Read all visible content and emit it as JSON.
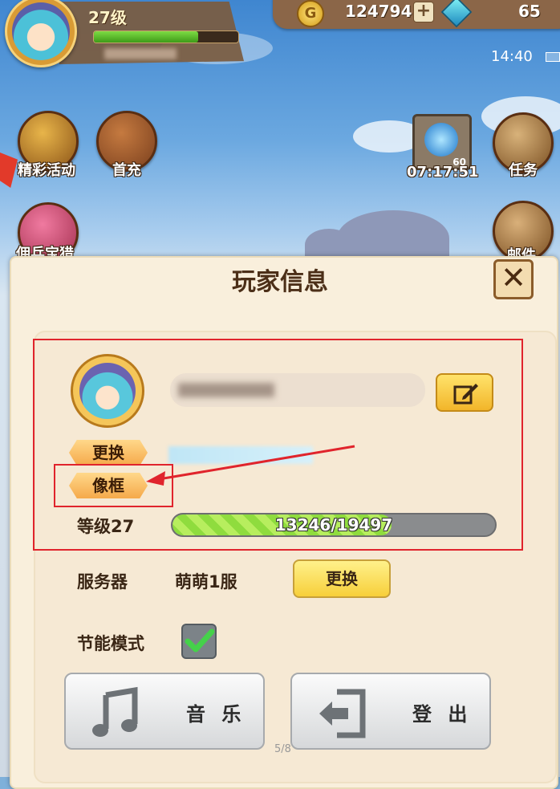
{
  "hud": {
    "level": "27级",
    "exp_fraction": 0.72,
    "gold": "124794",
    "gems": "65",
    "time": "14:40"
  },
  "world": {
    "events": "精彩活动",
    "first_charge": "首充",
    "portal_count": "60",
    "portal_timer": "07:17:51",
    "quests": "任务",
    "mercenary": "佣兵宝猎",
    "mail": "邮件"
  },
  "dialog": {
    "title": "玩家信息",
    "change_avatar_label": "更换",
    "frame_label": "像框",
    "level_label": "等级27",
    "exp_text": "13246/19497",
    "exp_fraction": 0.6794,
    "server_label": "服务器",
    "server_name": "萌萌1服",
    "change_server_label": "更换",
    "power_save_label": "节能模式",
    "power_save_checked": true,
    "music_label": "音 乐",
    "logout_label": "登 出"
  },
  "page_indicator": "5/8",
  "colors": {
    "annotation_red": "#e0242c",
    "exp_green": "#8fdc3e",
    "button_yellow": "#f7cf3a"
  }
}
